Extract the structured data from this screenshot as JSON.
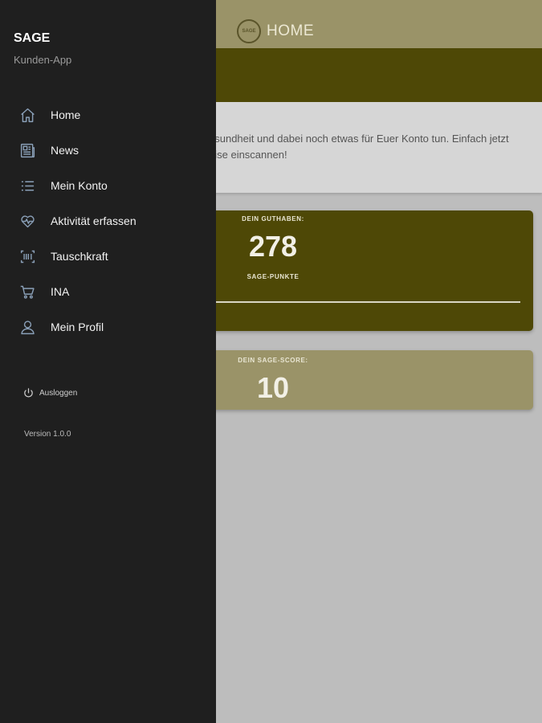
{
  "header": {
    "title": "HOME",
    "logo_text": "SAGE"
  },
  "intro": {
    "line1": "esundheit und dabei noch etwas für Euer Konto tun. Einfach jetzt",
    "line2": "eise einscannen!"
  },
  "balance_card": {
    "label": "DEIN GUTHABEN:",
    "value": "278",
    "unit": "SAGE-PUNKTE"
  },
  "score_card": {
    "label": "DEIN SAGE-SCORE:",
    "value": "10"
  },
  "drawer": {
    "title": "SAGE",
    "subtitle": "Kunden-App",
    "items": [
      {
        "label": "Home",
        "icon": "home-icon"
      },
      {
        "label": "News",
        "icon": "newspaper-icon"
      },
      {
        "label": "Mein Konto",
        "icon": "list-icon"
      },
      {
        "label": "Aktivität erfassen",
        "icon": "heart-pulse-icon"
      },
      {
        "label": "Tauschkraft",
        "icon": "scan-icon"
      },
      {
        "label": "INA",
        "icon": "cart-icon"
      },
      {
        "label": "Mein Profil",
        "icon": "person-icon"
      }
    ],
    "logout_label": "Ausloggen",
    "version": "Version 1.0.0"
  },
  "colors": {
    "drawer_bg": "#1f1f1f",
    "accent_dark": "#4e4806",
    "accent_light": "#9a9368"
  }
}
